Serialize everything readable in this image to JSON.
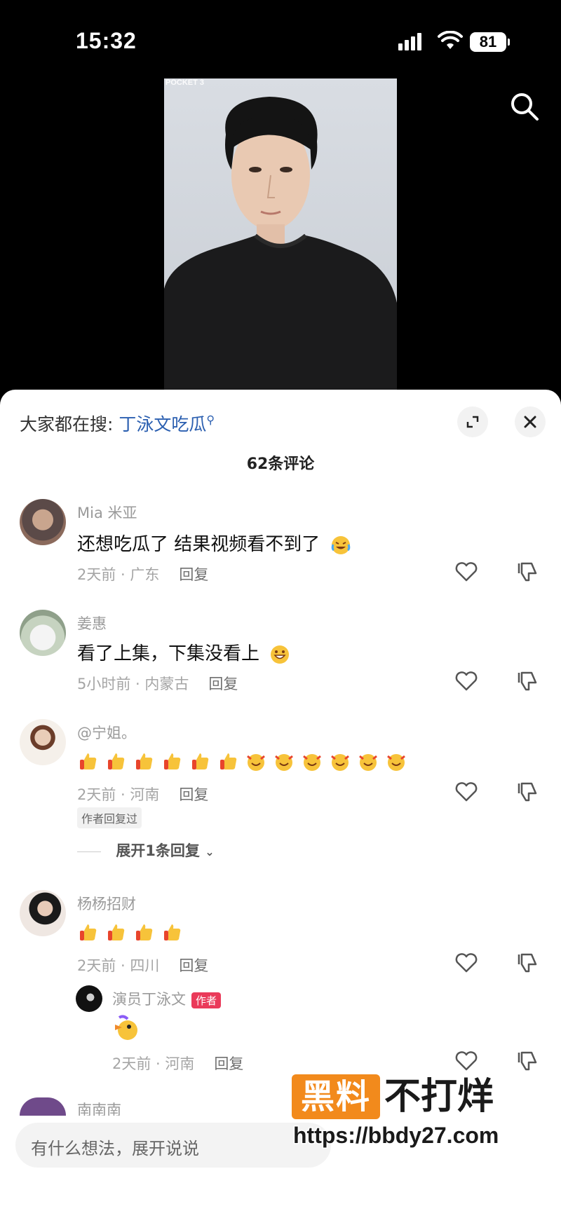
{
  "status_bar": {
    "time": "15:32",
    "battery": "81"
  },
  "video": {
    "camera_label": "POCKET 3"
  },
  "sheet": {
    "trending_prefix": "大家都在搜:",
    "trending_keyword": "丁泳文吃瓜",
    "comment_count": "62条评论"
  },
  "comments": [
    {
      "user": "Mia 米亚",
      "text": "还想吃瓜了 结果视频看不到了",
      "time_loc": "2天前 · 广东",
      "reply": "回复"
    },
    {
      "user": "姜惠",
      "text": "看了上集，下集没看上",
      "time_loc": "5小时前 · 内蒙古",
      "reply": "回复"
    },
    {
      "user": "@宁姐。",
      "time_loc": "2天前 · 河南",
      "reply": "回复",
      "tag": "作者回复过",
      "expand": "展开1条回复"
    },
    {
      "user": "杨杨招财",
      "time_loc": "2天前 · 四川",
      "reply": "回复"
    },
    {
      "user": "南南南"
    }
  ],
  "sub_reply": {
    "user": "演员丁泳文",
    "badge": "作者",
    "time_loc": "2天前 · 河南",
    "reply": "回复"
  },
  "input": {
    "placeholder": "有什么想法，展开说说"
  },
  "watermark": {
    "box": "黑料",
    "text": "不打烊",
    "url": "https://bbdy27.com"
  }
}
